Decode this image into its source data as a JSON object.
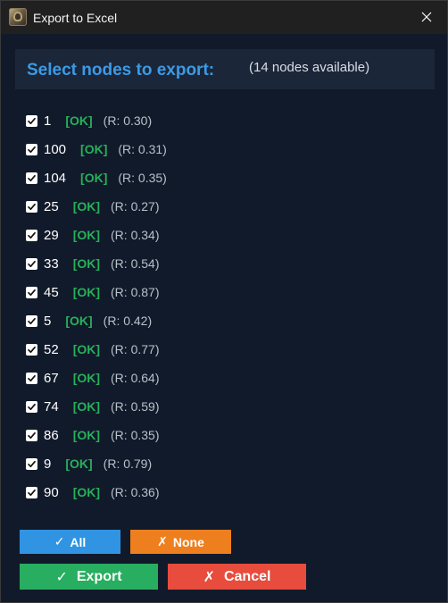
{
  "window": {
    "title": "Export to Excel"
  },
  "header": {
    "title": "Select nodes to export:",
    "count_text": "(14 nodes available)"
  },
  "nodes": [
    {
      "id": "1",
      "status": "[OK]",
      "r": "(R: 0.30)",
      "checked": true
    },
    {
      "id": "100",
      "status": "[OK]",
      "r": "(R: 0.31)",
      "checked": true
    },
    {
      "id": "104",
      "status": "[OK]",
      "r": "(R: 0.35)",
      "checked": true
    },
    {
      "id": "25",
      "status": "[OK]",
      "r": "(R: 0.27)",
      "checked": true
    },
    {
      "id": "29",
      "status": "[OK]",
      "r": "(R: 0.34)",
      "checked": true
    },
    {
      "id": "33",
      "status": "[OK]",
      "r": "(R: 0.54)",
      "checked": true
    },
    {
      "id": "45",
      "status": "[OK]",
      "r": "(R: 0.87)",
      "checked": true
    },
    {
      "id": "5",
      "status": "[OK]",
      "r": "(R: 0.42)",
      "checked": true
    },
    {
      "id": "52",
      "status": "[OK]",
      "r": "(R: 0.77)",
      "checked": true
    },
    {
      "id": "67",
      "status": "[OK]",
      "r": "(R: 0.64)",
      "checked": true
    },
    {
      "id": "74",
      "status": "[OK]",
      "r": "(R: 0.59)",
      "checked": true
    },
    {
      "id": "86",
      "status": "[OK]",
      "r": "(R: 0.35)",
      "checked": true
    },
    {
      "id": "9",
      "status": "[OK]",
      "r": "(R: 0.79)",
      "checked": true
    },
    {
      "id": "90",
      "status": "[OK]",
      "r": "(R: 0.36)",
      "checked": true
    }
  ],
  "buttons": {
    "all": {
      "glyph": "✓",
      "label": "All"
    },
    "none": {
      "glyph": "✗",
      "label": "None"
    },
    "export": {
      "glyph": "✓",
      "label": "Export"
    },
    "cancel": {
      "glyph": "✗",
      "label": "Cancel"
    }
  },
  "icons": {
    "app": "app-icon",
    "close": "close-icon",
    "checkmark": "checkmark-icon"
  },
  "colors": {
    "title_accent": "#3b9ae6",
    "status_ok": "#27b05a",
    "all_button": "#3094e2",
    "none_button": "#ee7f1f",
    "export_button": "#27ae60",
    "cancel_button": "#e74c3c"
  }
}
